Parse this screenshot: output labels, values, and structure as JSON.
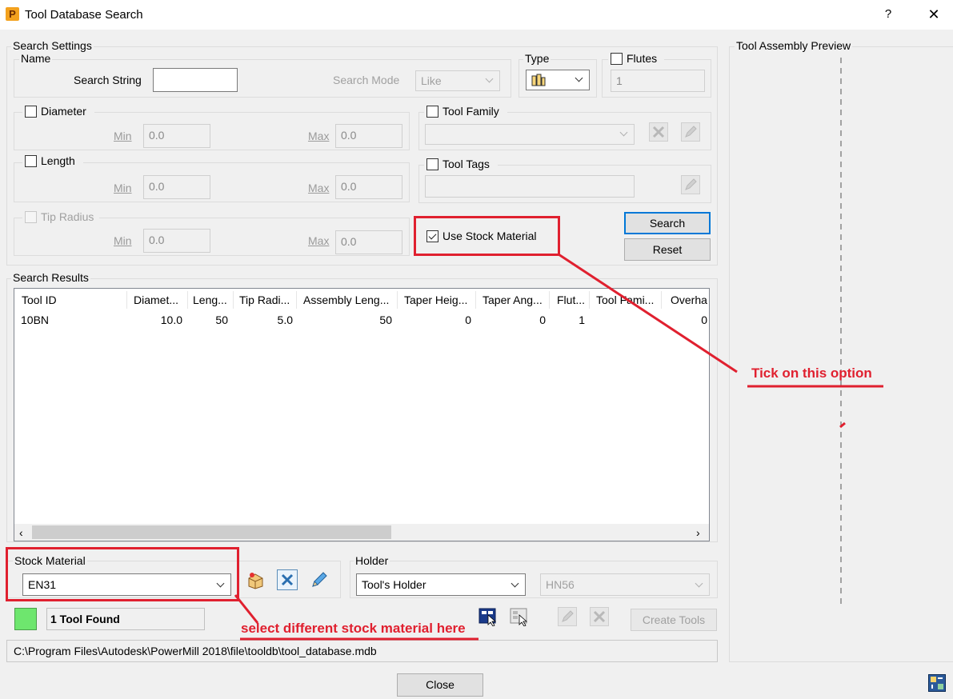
{
  "window": {
    "app_icon_letter": "P",
    "title": "Tool Database Search",
    "help": "?",
    "close": "✕"
  },
  "search_settings": {
    "label": "Search Settings",
    "name_group": {
      "label": "Name",
      "search_string_label": "Search String",
      "search_string_value": "",
      "search_mode_label": "Search Mode",
      "search_mode_value": "Like"
    },
    "type_group": {
      "label": "Type"
    },
    "flutes": {
      "label": "Flutes",
      "value": "1",
      "checked": false
    },
    "diameter": {
      "label": "Diameter",
      "min_label": "Min",
      "min_value": "0.0",
      "max_label": "Max",
      "max_value": "0.0",
      "checked": false
    },
    "length": {
      "label": "Length",
      "min_label": "Min",
      "min_value": "0.0",
      "max_label": "Max",
      "max_value": "0.0",
      "checked": false
    },
    "tip_radius": {
      "label": "Tip Radius",
      "min_label": "Min",
      "min_value": "0.0",
      "max_label": "Max",
      "max_value": "0.0",
      "checked": false
    },
    "tool_family": {
      "label": "Tool Family",
      "value": "",
      "checked": false
    },
    "tool_tags": {
      "label": "Tool Tags",
      "value": "",
      "checked": false
    },
    "use_stock_material": {
      "label": "Use Stock Material",
      "checked": true
    },
    "search_button": "Search",
    "reset_button": "Reset"
  },
  "results": {
    "label": "Search Results",
    "columns": [
      "Tool ID",
      "Diamet...",
      "Leng...",
      "Tip Radi...",
      "Assembly Leng...",
      "Taper Heig...",
      "Taper Ang...",
      "Flut...",
      "Tool Fami...",
      "Overha"
    ],
    "rows": [
      [
        "10BN",
        "10.0",
        "50",
        "5.0",
        "50",
        "0",
        "0",
        "1",
        "",
        "0"
      ]
    ]
  },
  "stock_material": {
    "label": "Stock Material",
    "value": "EN31"
  },
  "holder": {
    "label": "Holder",
    "value": "Tool's Holder",
    "secondary_value": "HN56"
  },
  "status": {
    "found_text": "1 Tool Found",
    "status_color": "#6ee66e",
    "create_tools_button": "Create Tools",
    "path": "C:\\Program Files\\Autodesk\\PowerMill 2018\\file\\tooldb\\tool_database.mdb"
  },
  "preview": {
    "label": "Tool Assembly Preview"
  },
  "close_button": "Close",
  "annotations": {
    "tick_option": "Tick on this option",
    "select_material": "select different stock material here",
    "color": "#e0202f"
  }
}
